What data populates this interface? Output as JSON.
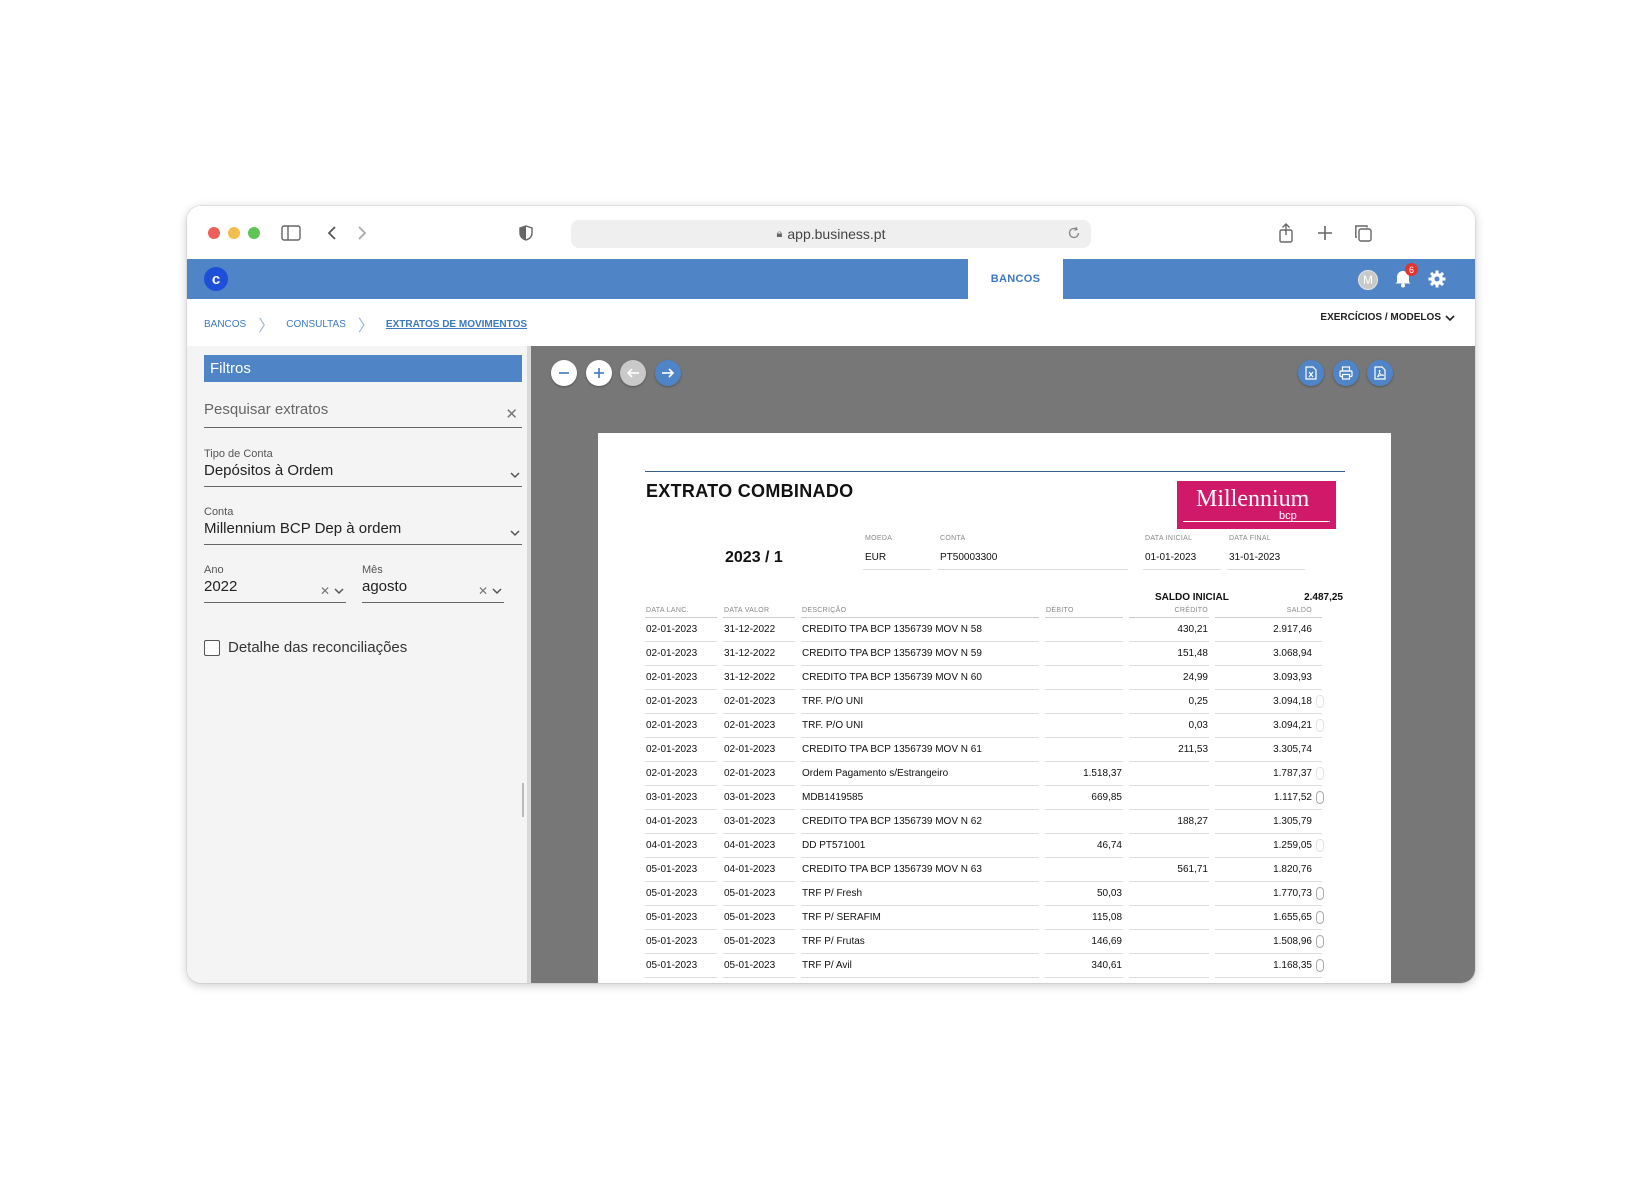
{
  "browser": {
    "url": "app.business.pt"
  },
  "app": {
    "logo_letter": "c",
    "active_tab": "BANCOS",
    "avatar_initial": "M",
    "notifications_count": "6"
  },
  "breadcrumb": {
    "items": [
      "BANCOS",
      "CONSULTAS",
      "EXTRATOS DE MOVIMENTOS"
    ]
  },
  "exercicios_label": "EXERCÍCIOS / MODELOS",
  "filters": {
    "title": "Filtros",
    "search_placeholder": "Pesquisar extratos",
    "tipo_conta": {
      "label": "Tipo de Conta",
      "value": "Depósitos à Ordem"
    },
    "conta": {
      "label": "Conta",
      "value": "Millennium BCP Dep à ordem"
    },
    "ano": {
      "label": "Ano",
      "value": "2022"
    },
    "mes": {
      "label": "Mês",
      "value": "agosto"
    },
    "detalhe_label": "Detalhe das reconciliações"
  },
  "statement": {
    "title": "EXTRATO COMBINADO",
    "bank_name": "Millennium",
    "bank_sub": "bcp",
    "period": "2023 / 1",
    "moeda_label": "MOEDA",
    "moeda": "EUR",
    "conta_label": "CONTA",
    "conta": "PT50003300",
    "data_inicial_label": "DATA INICIAL",
    "data_inicial": "01-01-2023",
    "data_final_label": "DATA FINAL",
    "data_final": "31-01-2023",
    "saldo_inicial_label": "SALDO INICIAL",
    "saldo_inicial": "2.487,25",
    "columns": [
      "DATA LANC.",
      "DATA VALOR",
      "DESCRIÇÃO",
      "DÉBITO",
      "CRÉDITO",
      "SALDO"
    ],
    "rows": [
      {
        "lanc": "02-01-2023",
        "valor": "31-12-2022",
        "desc": "CREDITO TPA BCP  1356739 MOV N 58",
        "debito": "",
        "credito": "430,21",
        "saldo": "2.917,46",
        "clip": "none"
      },
      {
        "lanc": "02-01-2023",
        "valor": "31-12-2022",
        "desc": "CREDITO TPA BCP  1356739 MOV N 59",
        "debito": "",
        "credito": "151,48",
        "saldo": "3.068,94",
        "clip": "none"
      },
      {
        "lanc": "02-01-2023",
        "valor": "31-12-2022",
        "desc": "CREDITO TPA BCP  1356739 MOV N 60",
        "debito": "",
        "credito": "24,99",
        "saldo": "3.093,93",
        "clip": "none"
      },
      {
        "lanc": "02-01-2023",
        "valor": "02-01-2023",
        "desc": "TRF. P/O  UNI",
        "debito": "",
        "credito": "0,25",
        "saldo": "3.094,18",
        "clip": "light"
      },
      {
        "lanc": "02-01-2023",
        "valor": "02-01-2023",
        "desc": "TRF. P/O  UNI",
        "debito": "",
        "credito": "0,03",
        "saldo": "3.094,21",
        "clip": "light"
      },
      {
        "lanc": "02-01-2023",
        "valor": "02-01-2023",
        "desc": "CREDITO TPA BCP  1356739 MOV N 61",
        "debito": "",
        "credito": "211,53",
        "saldo": "3.305,74",
        "clip": "none"
      },
      {
        "lanc": "02-01-2023",
        "valor": "02-01-2023",
        "desc": "Ordem Pagamento s/Estrangeiro",
        "debito": "1.518,37",
        "credito": "",
        "saldo": "1.787,37",
        "clip": "light"
      },
      {
        "lanc": "03-01-2023",
        "valor": "03-01-2023",
        "desc": "MDB1419585",
        "debito": "669,85",
        "credito": "",
        "saldo": "1.117,52",
        "clip": "dark"
      },
      {
        "lanc": "04-01-2023",
        "valor": "03-01-2023",
        "desc": "CREDITO TPA BCP  1356739 MOV N 62",
        "debito": "",
        "credito": "188,27",
        "saldo": "1.305,79",
        "clip": "none"
      },
      {
        "lanc": "04-01-2023",
        "valor": "04-01-2023",
        "desc": "DD PT571001",
        "debito": "46,74",
        "credito": "",
        "saldo": "1.259,05",
        "clip": "light"
      },
      {
        "lanc": "05-01-2023",
        "valor": "04-01-2023",
        "desc": "CREDITO TPA BCP  1356739 MOV N 63",
        "debito": "",
        "credito": "561,71",
        "saldo": "1.820,76",
        "clip": "none"
      },
      {
        "lanc": "05-01-2023",
        "valor": "05-01-2023",
        "desc": "TRF P/ Fresh",
        "debito": "50,03",
        "credito": "",
        "saldo": "1.770,73",
        "clip": "dark"
      },
      {
        "lanc": "05-01-2023",
        "valor": "05-01-2023",
        "desc": "TRF P/ SERAFIM",
        "debito": "115,08",
        "credito": "",
        "saldo": "1.655,65",
        "clip": "dark"
      },
      {
        "lanc": "05-01-2023",
        "valor": "05-01-2023",
        "desc": "TRF P/ Frutas",
        "debito": "146,69",
        "credito": "",
        "saldo": "1.508,96",
        "clip": "dark"
      },
      {
        "lanc": "05-01-2023",
        "valor": "05-01-2023",
        "desc": "TRF P/ Avil",
        "debito": "340,61",
        "credito": "",
        "saldo": "1.168,35",
        "clip": "dark"
      }
    ]
  }
}
